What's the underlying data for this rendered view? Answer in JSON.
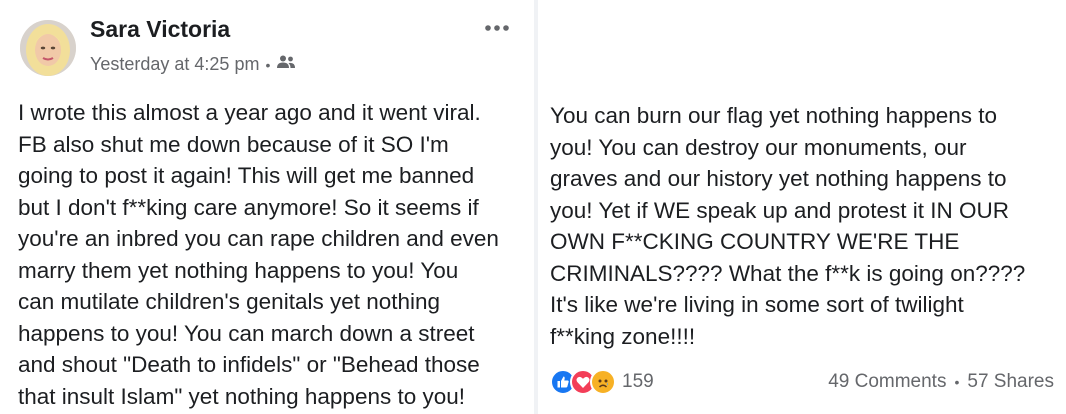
{
  "post": {
    "author": "Sara Victoria",
    "timestamp": "Yesterday at 4:25 pm",
    "separator": "•",
    "audience_icon": "friends-icon",
    "more_icon": "more-options-icon",
    "left_lines": [
      "I wrote this almost a year ago and it went viral.",
      "FB also shut me down because of it SO I'm",
      "going to post it again! This will get me banned",
      "but I don't f**king care anymore! So it seems if",
      "you're an inbred you can rape children and even",
      "marry them yet nothing happens to you! You",
      "can mutilate children's genitals yet nothing",
      "happens to you! You can march down a street",
      "and shout \"Death to infidels\" or \"Behead those",
      "that insult Islam\" yet nothing happens to you!"
    ],
    "right_lines": [
      "You can burn our flag yet nothing happens to",
      "you! You can destroy our monuments, our",
      "graves and our history yet nothing happens to",
      "you! Yet if WE speak up and protest it IN OUR",
      "OWN F**CKING COUNTRY WE'RE THE",
      "CRIMINALS???? What the f**k is going on????",
      "It's like we're living in some sort of twilight",
      "f**king zone!!!!"
    ],
    "reactions": {
      "icons": [
        "like-icon",
        "love-icon",
        "sad-icon"
      ],
      "count": "159"
    },
    "comments": "49 Comments",
    "shares": "57 Shares",
    "stats_separator": "•"
  },
  "colors": {
    "text": "#1c1e21",
    "meta": "#65676b",
    "like": "#1877f2",
    "love": "#f33e58",
    "sad": "#f7b125"
  }
}
